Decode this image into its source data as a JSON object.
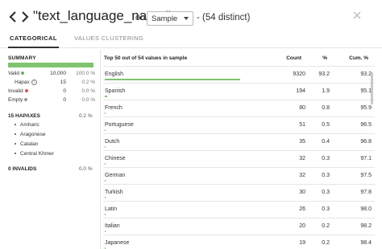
{
  "header": {
    "column_name": "\"text_language_name\"",
    "on_label": "on",
    "sample_value": "Sample",
    "distinct_text": "- (54 distinct)"
  },
  "tabs": [
    {
      "label": "CATEGORICAL",
      "active": true
    },
    {
      "label": "VALUES CLUSTERING",
      "active": false
    }
  ],
  "summary": {
    "title": "SUMMARY",
    "valid": {
      "label": "Valid",
      "count": "10,000",
      "pct": "100.0 %"
    },
    "hapax": {
      "label": "Hapax",
      "count": "15",
      "pct": "0.2 %"
    },
    "invalid": {
      "label": "Invalid",
      "count": "0",
      "pct": "0.0 %"
    },
    "empty": {
      "label": "Empty",
      "count": "0",
      "pct": "0.0 %"
    }
  },
  "hapaxes": {
    "title": "15 HAPAXES",
    "pct": "0.2 %",
    "items": [
      "Amharic",
      "Aragonese",
      "Catalan",
      "Central Khmer"
    ]
  },
  "invalids": {
    "title": "0 INVALIDS",
    "pct": "0.0 %"
  },
  "table": {
    "title": "Top 50 out of 54 values in sample",
    "col_count": "Count",
    "col_pct": "%",
    "col_cum": "Cum. %",
    "rows": [
      {
        "value": "English",
        "count": "9320",
        "pct": "93.2",
        "cum": "93.2",
        "share": 0.932
      },
      {
        "value": "Spanish",
        "count": "194",
        "pct": "1.9",
        "cum": "95.1",
        "share": 0.019
      },
      {
        "value": "French",
        "count": "80",
        "pct": "0.8",
        "cum": "95.9",
        "share": 0.008
      },
      {
        "value": "Portuguese",
        "count": "51",
        "pct": "0.5",
        "cum": "96.5",
        "share": 0.005
      },
      {
        "value": "Dutch",
        "count": "35",
        "pct": "0.4",
        "cum": "96.8",
        "share": 0.004
      },
      {
        "value": "Chinese",
        "count": "32",
        "pct": "0.3",
        "cum": "97.1",
        "share": 0.003
      },
      {
        "value": "German",
        "count": "32",
        "pct": "0.3",
        "cum": "97.5",
        "share": 0.003
      },
      {
        "value": "Turkish",
        "count": "30",
        "pct": "0.3",
        "cum": "97.8",
        "share": 0.003
      },
      {
        "value": "Latin",
        "count": "26",
        "pct": "0.3",
        "cum": "98.0",
        "share": 0.003
      },
      {
        "value": "Italian",
        "count": "20",
        "pct": "0.2",
        "cum": "98.2",
        "share": 0.002
      },
      {
        "value": "Japanese",
        "count": "19",
        "pct": "0.2",
        "cum": "98.4",
        "share": 0.002
      }
    ]
  },
  "colors": {
    "bar_green": "#7fc46f",
    "valid_dot": "#5cb85c",
    "invalid_dot": "#d9534f",
    "empty_dot": "#999999"
  }
}
